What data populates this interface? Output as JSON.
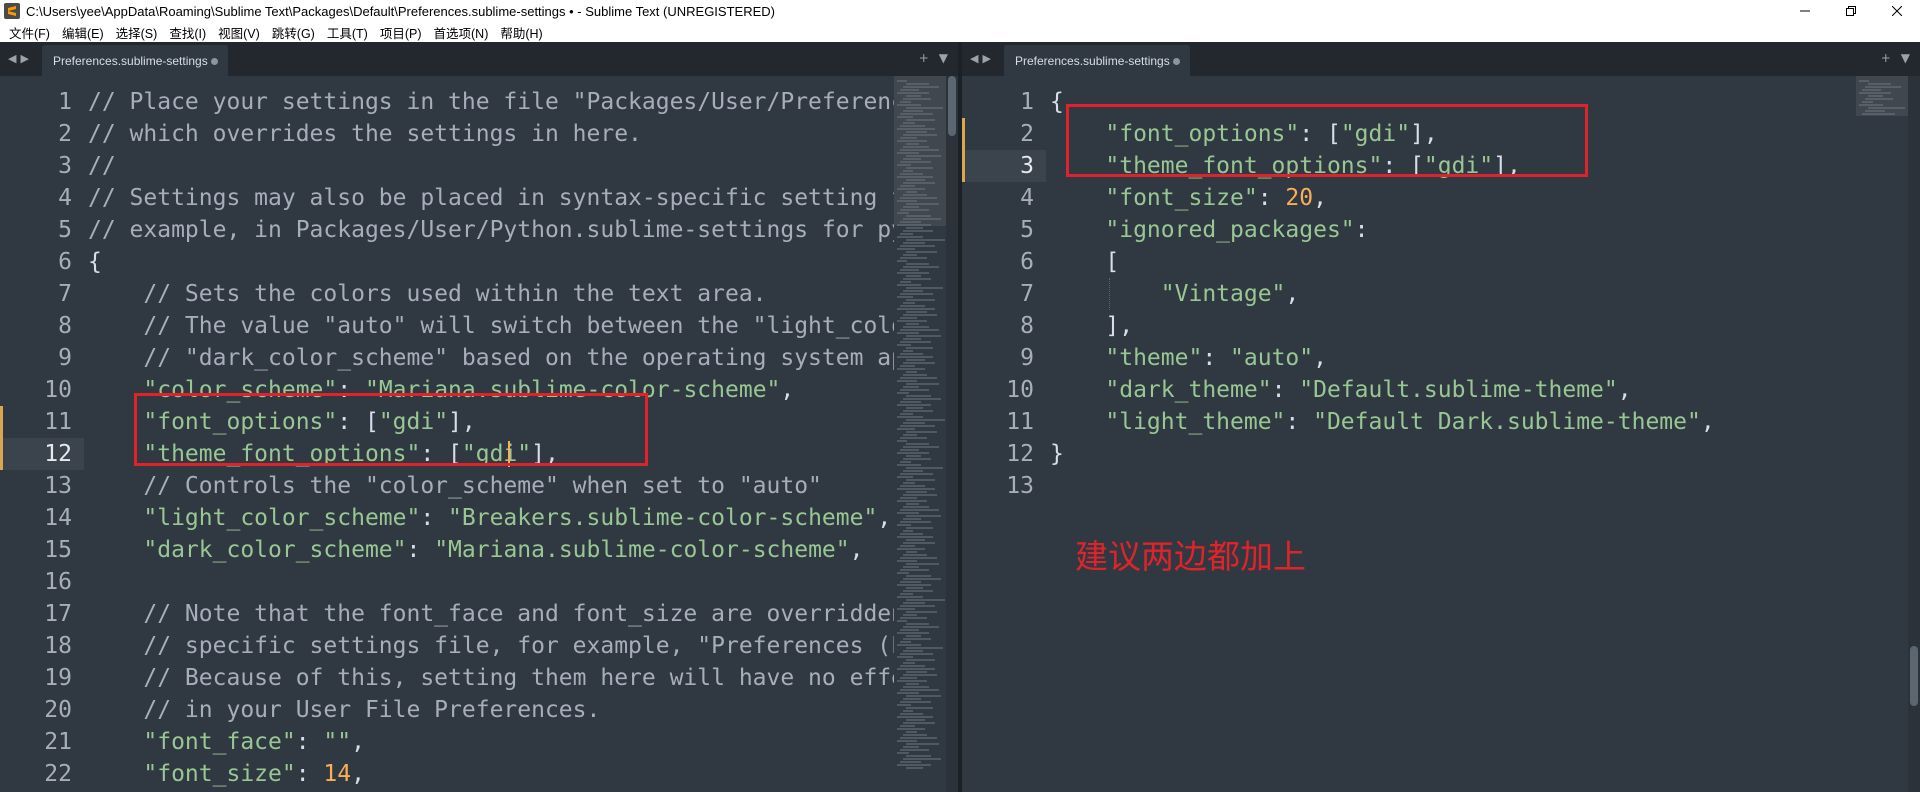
{
  "window": {
    "title": "C:\\Users\\yee\\AppData\\Roaming\\Sublime Text\\Packages\\Default\\Preferences.sublime-settings • - Sublime Text (UNREGISTERED)",
    "app_icon": "sublime-text-icon"
  },
  "menu": [
    "文件(F)",
    "编辑(E)",
    "选择(S)",
    "查找(I)",
    "视图(V)",
    "跳转(G)",
    "工具(T)",
    "项目(P)",
    "首选项(N)",
    "帮助(H)"
  ],
  "left_pane": {
    "tab_label": "Preferences.sublime-settings",
    "current_line": 12,
    "lines": [
      [
        {
          "t": "c",
          "v": "// Place your settings in the file \"Packages/User/Preferences.sublime-settings\","
        }
      ],
      [
        {
          "t": "c",
          "v": "// which overrides the settings in here."
        }
      ],
      [
        {
          "t": "c",
          "v": "//"
        }
      ],
      [
        {
          "t": "c",
          "v": "// Settings may also be placed in syntax-specific setting files, for"
        }
      ],
      [
        {
          "t": "c",
          "v": "// example, in Packages/User/Python.sublime-settings for python files."
        }
      ],
      [
        {
          "t": "p",
          "v": "{"
        }
      ],
      [
        {
          "t": "p",
          "v": "    "
        },
        {
          "t": "c",
          "v": "// Sets the colors used within the text area."
        }
      ],
      [
        {
          "t": "p",
          "v": "    "
        },
        {
          "t": "c",
          "v": "// The value \"auto\" will switch between the \"light_color_scheme\" and"
        }
      ],
      [
        {
          "t": "p",
          "v": "    "
        },
        {
          "t": "c",
          "v": "// \"dark_color_scheme\" based on the operating system appearance."
        }
      ],
      [
        {
          "t": "p",
          "v": "    "
        },
        {
          "t": "s",
          "v": "\"color_scheme\""
        },
        {
          "t": "p",
          "v": ": "
        },
        {
          "t": "s",
          "v": "\"Mariana.sublime-color-scheme\""
        },
        {
          "t": "p",
          "v": ","
        }
      ],
      [
        {
          "t": "p",
          "v": "    "
        },
        {
          "t": "s",
          "v": "\"font_options\""
        },
        {
          "t": "p",
          "v": ": ["
        },
        {
          "t": "s",
          "v": "\"gdi\""
        },
        {
          "t": "p",
          "v": "],"
        }
      ],
      [
        {
          "t": "p",
          "v": "    "
        },
        {
          "t": "s",
          "v": "\"theme_font_options\""
        },
        {
          "t": "p",
          "v": ": ["
        },
        {
          "t": "s",
          "v": "\"gdi\""
        },
        {
          "t": "p",
          "v": "],"
        }
      ],
      [
        {
          "t": "p",
          "v": "    "
        },
        {
          "t": "c",
          "v": "// Controls the \"color_scheme\" when set to \"auto\""
        }
      ],
      [
        {
          "t": "p",
          "v": "    "
        },
        {
          "t": "s",
          "v": "\"light_color_scheme\""
        },
        {
          "t": "p",
          "v": ": "
        },
        {
          "t": "s",
          "v": "\"Breakers.sublime-color-scheme\""
        },
        {
          "t": "p",
          "v": ","
        }
      ],
      [
        {
          "t": "p",
          "v": "    "
        },
        {
          "t": "s",
          "v": "\"dark_color_scheme\""
        },
        {
          "t": "p",
          "v": ": "
        },
        {
          "t": "s",
          "v": "\"Mariana.sublime-color-scheme\""
        },
        {
          "t": "p",
          "v": ","
        }
      ],
      [],
      [
        {
          "t": "p",
          "v": "    "
        },
        {
          "t": "c",
          "v": "// Note that the font_face and font_size are overridden in the platform"
        }
      ],
      [
        {
          "t": "p",
          "v": "    "
        },
        {
          "t": "c",
          "v": "// specific settings file, for example, \"Preferences (Linux).sublime-settings\"."
        }
      ],
      [
        {
          "t": "p",
          "v": "    "
        },
        {
          "t": "c",
          "v": "// Because of this, setting them here will have no effect: you must set them"
        }
      ],
      [
        {
          "t": "p",
          "v": "    "
        },
        {
          "t": "c",
          "v": "// in your User File Preferences."
        }
      ],
      [
        {
          "t": "p",
          "v": "    "
        },
        {
          "t": "s",
          "v": "\"font_face\""
        },
        {
          "t": "p",
          "v": ": "
        },
        {
          "t": "s",
          "v": "\"\""
        },
        {
          "t": "p",
          "v": ","
        }
      ],
      [
        {
          "t": "p",
          "v": "    "
        },
        {
          "t": "s",
          "v": "\"font_size\""
        },
        {
          "t": "p",
          "v": ": "
        },
        {
          "t": "n",
          "v": "14"
        },
        {
          "t": "p",
          "v": ","
        }
      ],
      []
    ]
  },
  "right_pane": {
    "tab_label": "Preferences.sublime-settings",
    "current_line": 3,
    "lines": [
      [
        {
          "t": "p",
          "v": "{"
        }
      ],
      [
        {
          "t": "p",
          "v": "    "
        },
        {
          "t": "s",
          "v": "\"font_options\""
        },
        {
          "t": "p",
          "v": ": ["
        },
        {
          "t": "s",
          "v": "\"gdi\""
        },
        {
          "t": "p",
          "v": "],"
        }
      ],
      [
        {
          "t": "p",
          "v": "    "
        },
        {
          "t": "s",
          "v": "\"theme_font_options\""
        },
        {
          "t": "p",
          "v": ": ["
        },
        {
          "t": "s",
          "v": "\"gdi\""
        },
        {
          "t": "p",
          "v": "],"
        }
      ],
      [
        {
          "t": "p",
          "v": "    "
        },
        {
          "t": "s",
          "v": "\"font_size\""
        },
        {
          "t": "p",
          "v": ": "
        },
        {
          "t": "n",
          "v": "20"
        },
        {
          "t": "p",
          "v": ","
        }
      ],
      [
        {
          "t": "p",
          "v": "    "
        },
        {
          "t": "s",
          "v": "\"ignored_packages\""
        },
        {
          "t": "p",
          "v": ":"
        }
      ],
      [
        {
          "t": "p",
          "v": "    ["
        }
      ],
      [
        {
          "t": "p",
          "v": "        "
        },
        {
          "t": "s",
          "v": "\"Vintage\""
        },
        {
          "t": "p",
          "v": ","
        }
      ],
      [
        {
          "t": "p",
          "v": "    ],"
        }
      ],
      [
        {
          "t": "p",
          "v": "    "
        },
        {
          "t": "s",
          "v": "\"theme\""
        },
        {
          "t": "p",
          "v": ": "
        },
        {
          "t": "s",
          "v": "\"auto\""
        },
        {
          "t": "p",
          "v": ","
        }
      ],
      [
        {
          "t": "p",
          "v": "    "
        },
        {
          "t": "s",
          "v": "\"dark_theme\""
        },
        {
          "t": "p",
          "v": ": "
        },
        {
          "t": "s",
          "v": "\"Default.sublime-theme\""
        },
        {
          "t": "p",
          "v": ","
        }
      ],
      [
        {
          "t": "p",
          "v": "    "
        },
        {
          "t": "s",
          "v": "\"light_theme\""
        },
        {
          "t": "p",
          "v": ": "
        },
        {
          "t": "s",
          "v": "\"Default Dark.sublime-theme\""
        },
        {
          "t": "p",
          "v": ","
        }
      ],
      [
        {
          "t": "p",
          "v": "}"
        }
      ],
      []
    ]
  },
  "annotation": {
    "text": "建议两边都加上",
    "color": "#e0232b"
  },
  "colors": {
    "background": "#303841",
    "comment": "#a7adba",
    "string": "#99c794",
    "number": "#f9ae58",
    "modified_marker": "#d9a651"
  }
}
